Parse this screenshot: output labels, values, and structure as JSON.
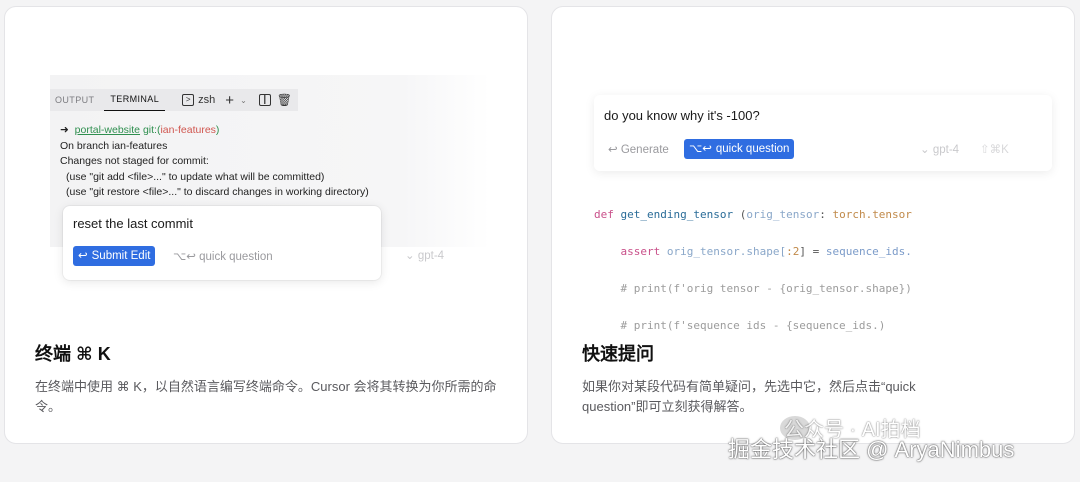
{
  "left_card": {
    "terminal": {
      "tabs": [
        "OUTPUT",
        "TERMINAL"
      ],
      "shell": "zsh",
      "icons": [
        "terminal-icon",
        "plus-icon",
        "chevron-down-icon",
        "split-icon",
        "trash-icon"
      ],
      "prompt_arrow": "➜",
      "prompt_dir": "portal-website",
      "prompt_git": "git:(",
      "prompt_branch": "ian-features",
      "prompt_close": ")",
      "lines": [
        "On branch ian-features",
        "Changes not staged for commit:",
        "(use \"git add <file>...\" to update what will be committed)",
        "(use \"git restore <file>...\" to discard changes in working directory)"
      ]
    },
    "prompt": {
      "text": "reset the last commit",
      "submit_label": "Submit Edit",
      "quick_question_label": "quick question",
      "model_label": "gpt-4"
    },
    "title": "终端 ⌘ K",
    "description": "在终端中使用 ⌘ K，以自然语言编写终端命令。Cursor 会将其转换为你所需的命令。"
  },
  "right_card": {
    "question": "do you know why it's -100?",
    "generate_label": "Generate",
    "quick_question_label": "quick question",
    "model_label": "gpt-4",
    "shortcut_label": "⇧⌘K",
    "code": {
      "line1_kw": "def ",
      "line1_fn": "get_ending_tensor",
      "line1_open": " (",
      "line1_param": "orig_tensor",
      "line1_colon": ": ",
      "line1_type": "torch.tensor",
      "line2_kw": "assert ",
      "line2_a": "orig_tensor.shape[",
      "line2_num": ":2",
      "line2_b": "] = ",
      "line2_c": "sequence_ids.",
      "line3": "# print(f'orig tensor - {orig_tensor.shape})",
      "line4": "# print(f'sequence ids - {sequence_ids.)"
    },
    "title": "快速提问",
    "description": "如果你对某段代码有简单疑问，先选中它，然后点击“quick question”即可立刻获得解答。"
  },
  "watermark": {
    "line1": "公众号 · AI拍档",
    "line2": "掘金技术社区 @ AryaNimbus"
  },
  "colors": {
    "accent": "#2f6de1",
    "background": "#f4f4f5",
    "card": "#ffffff"
  }
}
